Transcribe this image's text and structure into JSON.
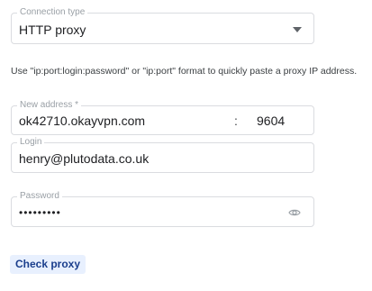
{
  "connection_type": {
    "label": "Connection type",
    "value": "HTTP proxy",
    "icon": "chevron-down-icon"
  },
  "hint": "Use \"ip:port:login:password\" or \"ip:port\" format to quickly paste a proxy IP address.",
  "address": {
    "label": "New address *",
    "host": "ok42710.okayvpn.com",
    "separator": ":",
    "port": "9604"
  },
  "login": {
    "label": "Login",
    "value": "henry@plutodata.co.uk"
  },
  "password": {
    "label": "Password",
    "value": "•••••••••",
    "icon": "eye-icon"
  },
  "actions": {
    "check_label": "Check proxy"
  },
  "colors": {
    "border": "#dadce0",
    "label": "#9aa0a6",
    "button_bg": "#e8f0fe",
    "button_text": "#1a3e8c"
  }
}
